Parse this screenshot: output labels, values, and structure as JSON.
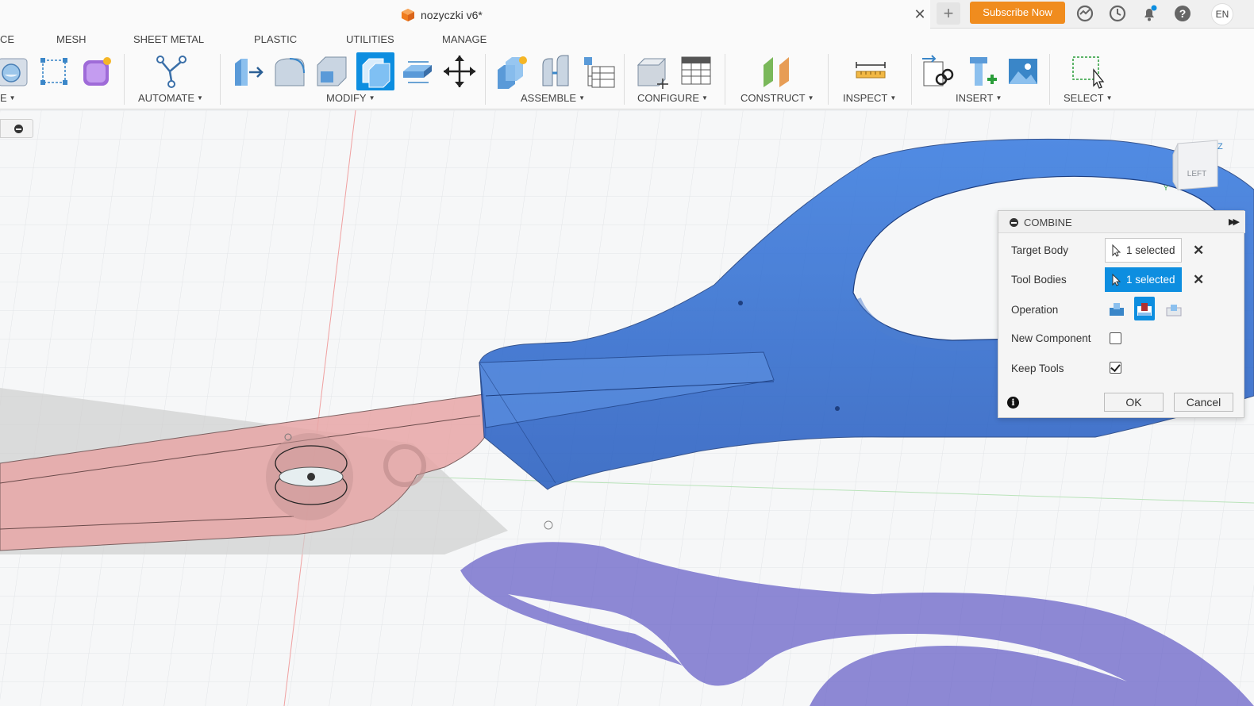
{
  "document": {
    "title": "nozyczki v6*"
  },
  "topbar": {
    "subscribe_label": "Subscribe Now",
    "language": "EN",
    "icons": [
      "online-status-icon",
      "history-icon",
      "notifications-icon",
      "help-icon"
    ]
  },
  "ribbon": {
    "tabs": [
      "CE",
      "MESH",
      "SHEET METAL",
      "PLASTIC",
      "UTILITIES",
      "MANAGE"
    ],
    "groups": {
      "partial": "E",
      "automate": "AUTOMATE",
      "modify": "MODIFY",
      "assemble": "ASSEMBLE",
      "configure": "CONFIGURE",
      "construct": "CONSTRUCT",
      "inspect": "INSPECT",
      "insert": "INSERT",
      "select": "SELECT"
    }
  },
  "viewcube": {
    "face_label": "LEFT",
    "axis_z": "Z",
    "axis_y": "Y"
  },
  "combine_dialog": {
    "title": "COMBINE",
    "target_body_label": "Target Body",
    "target_body_value": "1 selected",
    "tool_bodies_label": "Tool Bodies",
    "tool_bodies_value": "1 selected",
    "operation_label": "Operation",
    "operation_selected": "cut",
    "new_component_label": "New Component",
    "new_component_checked": false,
    "keep_tools_label": "Keep Tools",
    "keep_tools_checked": true,
    "ok_label": "OK",
    "cancel_label": "Cancel"
  },
  "colors": {
    "accent": "#0d8ee0",
    "subscribe": "#f08c1e",
    "body_blue": "#2f6fd1",
    "body_pink": "#e8a0a0"
  }
}
